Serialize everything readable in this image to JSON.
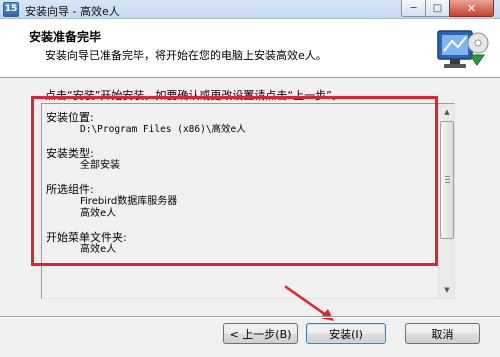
{
  "window": {
    "icon_text": "15",
    "title": "安装向导 - 高效e人",
    "min_glyph": "─",
    "max_glyph": "□",
    "close_glyph": "✕"
  },
  "header": {
    "title": "安装准备完毕",
    "subtitle": "安装向导已准备完毕，将开始在您的电脑上安装高效e人。"
  },
  "instruction": "点击“安装”开始安装。如要确认或更改设置请点击“上一步”。",
  "memo": {
    "sections": [
      {
        "label": "安装位置:",
        "value": "D:\\Program Files (x86)\\高效e人"
      },
      {
        "label": "安装类型:",
        "value": "全部安装"
      },
      {
        "label": "所选组件:",
        "values": [
          "Firebird数据库服务器",
          "高效e人"
        ]
      },
      {
        "label": "开始菜单文件夹:",
        "value": "高效e人"
      }
    ]
  },
  "scrollbar": {
    "up_glyph": "▲",
    "down_glyph": "▼"
  },
  "buttons": {
    "back": "< 上一步(B)",
    "install": "安装(I)",
    "cancel": "取消"
  },
  "colors": {
    "highlight": "#e0232e",
    "header_bg": "#ffffff",
    "window_bg": "#f0f0f0"
  },
  "icons": [
    "app-icon",
    "computer-install-icon",
    "red-pointer-arrow"
  ]
}
